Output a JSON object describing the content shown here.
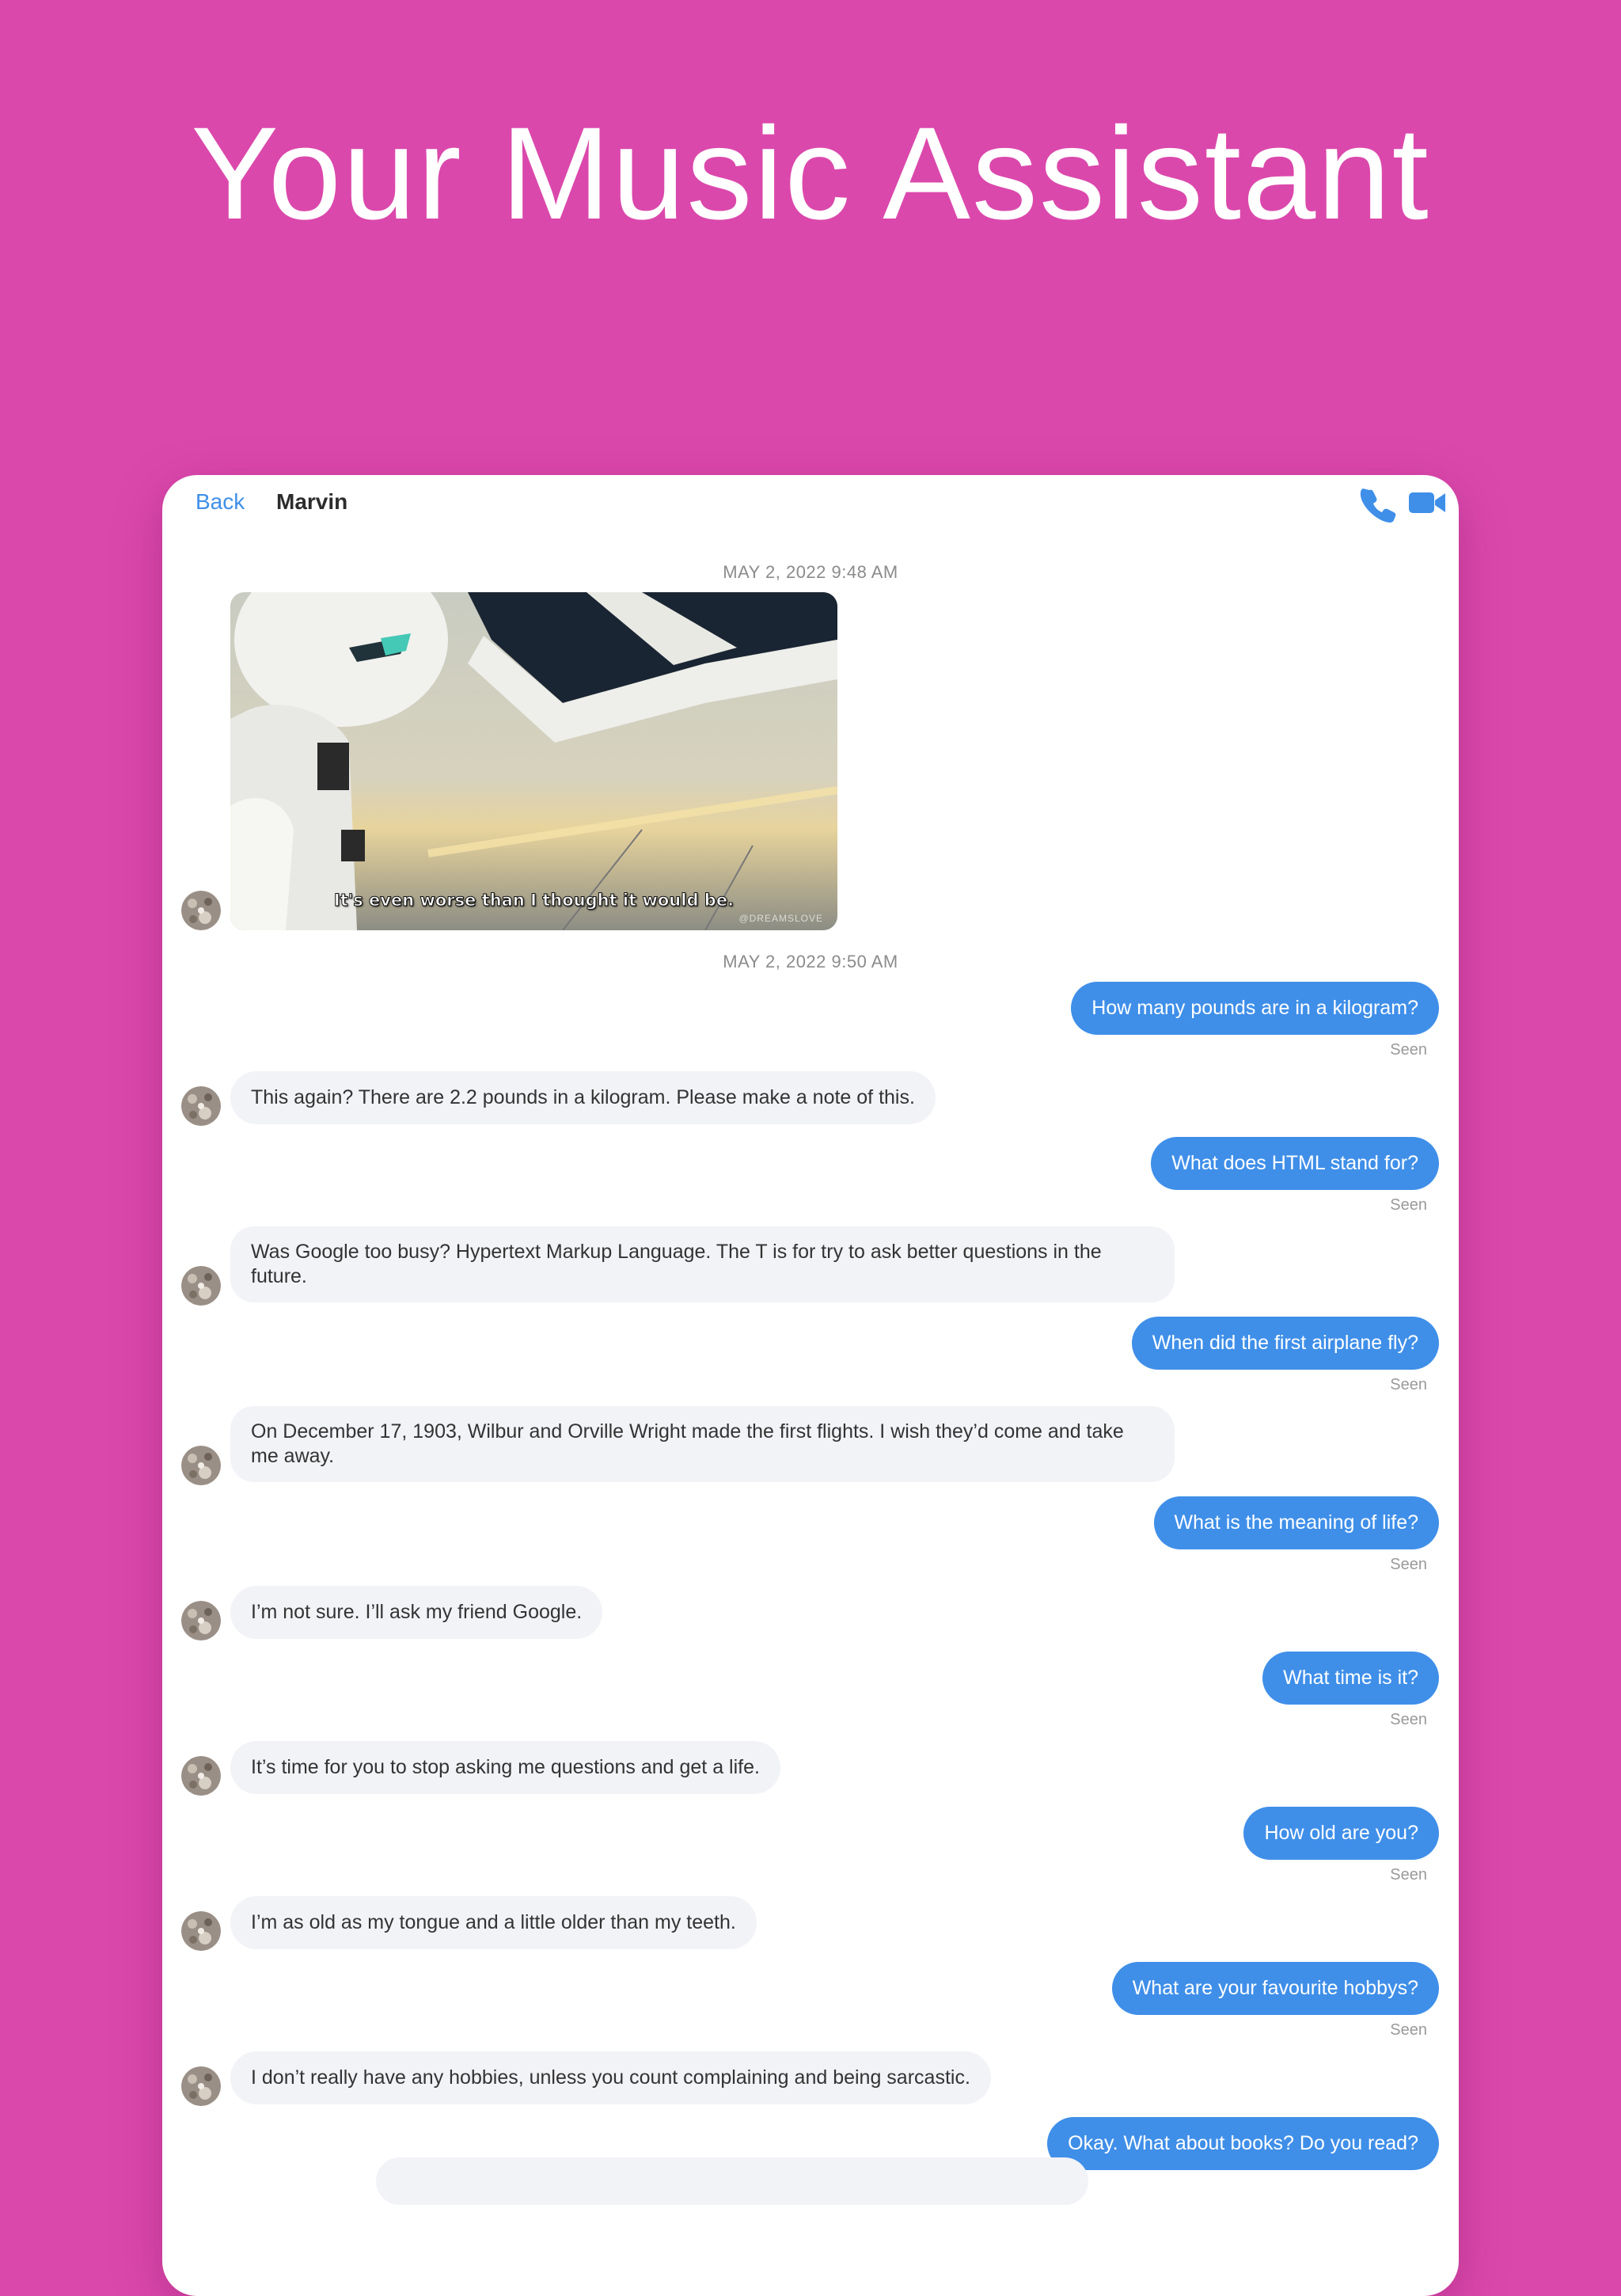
{
  "hero": {
    "title": "Your Music Assistant"
  },
  "colors": {
    "background": "#db48ac",
    "accent": "#3f8fe9",
    "incoming_bubble": "#f2f3f7"
  },
  "chat": {
    "back_label": "Back",
    "contact_name": "Marvin",
    "call_icon": "phone-icon",
    "video_icon": "video-camera-icon",
    "timestamps": [
      "MAY 2, 2022 9:48 AM",
      "MAY 2, 2022 9:50 AM"
    ],
    "media": {
      "subtitle": "It's even worse than I thought it would be.",
      "watermark": "@DREAMSLOVE"
    },
    "seen_label": "Seen",
    "messages": [
      {
        "from": "me",
        "text": "How many pounds are in a kilogram?"
      },
      {
        "from": "marvin",
        "text": "This again? There are 2.2 pounds in a kilogram. Please make a note of this."
      },
      {
        "from": "me",
        "text": "What does HTML stand for?"
      },
      {
        "from": "marvin",
        "text": "Was Google too busy? Hypertext Markup Language. The T is for try to ask better questions in the future."
      },
      {
        "from": "me",
        "text": "When did the first airplane fly?"
      },
      {
        "from": "marvin",
        "text": "On December 17, 1903, Wilbur and Orville Wright made the first flights. I wish they’d come and take me away."
      },
      {
        "from": "me",
        "text": "What is the meaning of life?"
      },
      {
        "from": "marvin",
        "text": "I’m not sure. I’ll ask my friend Google."
      },
      {
        "from": "me",
        "text": "What time is it?"
      },
      {
        "from": "marvin",
        "text": "It’s time for you to stop asking me questions and get a life."
      },
      {
        "from": "me",
        "text": "How old are you?"
      },
      {
        "from": "marvin",
        "text": "I’m as old as my tongue and a little older than my teeth."
      },
      {
        "from": "me",
        "text": "What are your favourite hobbys?"
      },
      {
        "from": "marvin",
        "text": "I don’t really have any hobbies, unless you count complaining and being sarcastic."
      },
      {
        "from": "me",
        "text": "Okay. What about books? Do you read?"
      }
    ]
  }
}
